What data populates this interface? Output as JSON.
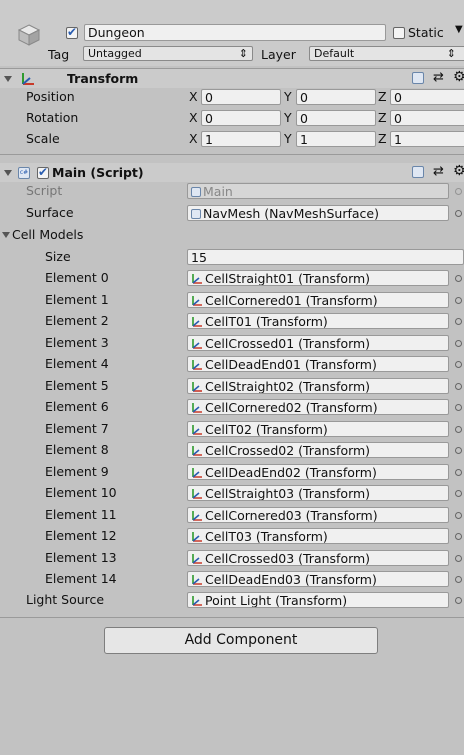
{
  "gameobject": {
    "name": "Dungeon",
    "active": true,
    "static_label": "Static",
    "static_checked": false,
    "tag_label": "Tag",
    "tag_value": "Untagged",
    "layer_label": "Layer",
    "layer_value": "Default"
  },
  "transform": {
    "title": "Transform",
    "rows": [
      {
        "label": "Position",
        "x": "0",
        "y": "0",
        "z": "0"
      },
      {
        "label": "Rotation",
        "x": "0",
        "y": "0",
        "z": "0"
      },
      {
        "label": "Scale",
        "x": "1",
        "y": "1",
        "z": "1"
      }
    ],
    "axes": [
      "X",
      "Y",
      "Z"
    ]
  },
  "script": {
    "title": "Main (Script)",
    "enabled": true,
    "script_label": "Script",
    "script_value": "Main",
    "surface_label": "Surface",
    "surface_value": "NavMesh (NavMeshSurface)",
    "cell_models_label": "Cell Models",
    "size_label": "Size",
    "size_value": "15",
    "elements": [
      {
        "label": "Element 0",
        "value": "CellStraight01 (Transform)"
      },
      {
        "label": "Element 1",
        "value": "CellCornered01 (Transform)"
      },
      {
        "label": "Element 2",
        "value": "CellT01 (Transform)"
      },
      {
        "label": "Element 3",
        "value": "CellCrossed01 (Transform)"
      },
      {
        "label": "Element 4",
        "value": "CellDeadEnd01 (Transform)"
      },
      {
        "label": "Element 5",
        "value": "CellStraight02 (Transform)"
      },
      {
        "label": "Element 6",
        "value": "CellCornered02 (Transform)"
      },
      {
        "label": "Element 7",
        "value": "CellT02 (Transform)"
      },
      {
        "label": "Element 8",
        "value": "CellCrossed02 (Transform)"
      },
      {
        "label": "Element 9",
        "value": "CellDeadEnd02 (Transform)"
      },
      {
        "label": "Element 10",
        "value": "CellStraight03 (Transform)"
      },
      {
        "label": "Element 11",
        "value": "CellCornered03 (Transform)"
      },
      {
        "label": "Element 12",
        "value": "CellT03 (Transform)"
      },
      {
        "label": "Element 13",
        "value": "CellCrossed03 (Transform)"
      },
      {
        "label": "Element 14",
        "value": "CellDeadEnd03 (Transform)"
      }
    ],
    "light_source_label": "Light Source",
    "light_source_value": "Point Light (Transform)"
  },
  "add_component_label": "Add Component",
  "colors": {
    "panel": "#c2c2c2",
    "header": "#cbcbcb",
    "field": "#f0f0f0",
    "accent": "#2a5db0"
  }
}
